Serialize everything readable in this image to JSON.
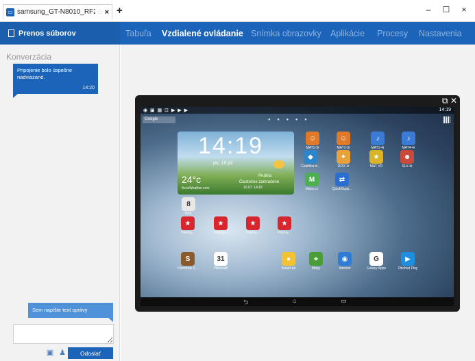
{
  "window": {
    "tab_title": "samsung_GT-N8010_RF2DB107KNV",
    "tab_star": "☆",
    "tab_close": "×",
    "new_tab": "+",
    "minimize": "–",
    "maximize": "☐",
    "close": "×"
  },
  "nav": {
    "file_transfer": "Prenos súborov",
    "items": [
      {
        "label": "Tabuľa"
      },
      {
        "label": "Vzdialené ovládanie"
      },
      {
        "label": "Snímka obrazovky"
      },
      {
        "label": "Aplikácie"
      },
      {
        "label": "Procesy"
      },
      {
        "label": "Nastavenia"
      }
    ],
    "active_index": 1
  },
  "sidebar": {
    "title": "Konverzácia",
    "messages": [
      {
        "text": "Pripojenie bolo úspešne nadviazané.",
        "time": "14:20"
      }
    ],
    "placeholder_bubble": "Sem napíšte text správy",
    "input_value": "",
    "send_label": "Odoslať"
  },
  "device": {
    "status_time": "14:19",
    "status_left": "◉ ▣ ▦ ⊡ ▶ ▶ ▶",
    "google_label": "Google",
    "clock": "14:19",
    "date": "po, 10 júl",
    "temperature": "24°c",
    "city": "Prutina",
    "condition": "Čiastočne zamračené",
    "weather_source": "AccuWeather.com",
    "updated": "10.07. 14:18",
    "apps": [
      {
        "label": "MAT1-3r",
        "color": "#e07a2a",
        "glyph": "☺"
      },
      {
        "label": "MAT1-3r",
        "color": "#e07a2a",
        "glyph": "☺"
      },
      {
        "label": "MAT1-4r",
        "color": "#3a7bd5",
        "glyph": "♪"
      },
      {
        "label": "MAT4-4r",
        "color": "#3a7bd5",
        "glyph": "♪"
      },
      {
        "label": "Cestička d...",
        "color": "#2c86c9",
        "glyph": "◆"
      },
      {
        "label": "DOV-1r",
        "color": "#e9a23b",
        "glyph": "✦"
      },
      {
        "label": "MAT VR",
        "color": "#d9b42a",
        "glyph": "★"
      },
      {
        "label": "SLV-4r",
        "color": "#c94a3a",
        "glyph": "☻"
      },
      {
        "label": "Mapy.cz",
        "color": "#4caf50",
        "glyph": "M"
      },
      {
        "label": "QuickSupp...",
        "color": "#2a6fd0",
        "glyph": "⇄"
      },
      {
        "label": "PPK",
        "color": "#e8e8e8",
        "glyph": "8"
      },
      {
        "label": "Priloha...",
        "color": "#d7262e",
        "glyph": "★"
      },
      {
        "label": "Priloha...",
        "color": "#d7262e",
        "glyph": "★"
      },
      {
        "label": "Priloha...",
        "color": "#d7262e",
        "glyph": "★"
      },
      {
        "label": "Priloha...",
        "color": "#d7262e",
        "glyph": "★"
      },
      {
        "label": "Pomôcka S...",
        "color": "#8a5a2b",
        "glyph": "S"
      },
      {
        "label": "Plánovač",
        "color": "#ffffff",
        "glyph": "31"
      },
      {
        "label": "Smart-ek",
        "color": "#f1c232",
        "glyph": "●"
      },
      {
        "label": "Mapy",
        "color": "#4a9e3a",
        "glyph": "⌖"
      },
      {
        "label": "Internet",
        "color": "#2e7cd6",
        "glyph": "◉"
      },
      {
        "label": "Galaxy Apps",
        "color": "#ffffff",
        "glyph": "G"
      },
      {
        "label": "Obchod Play",
        "color": "#1f8de0",
        "glyph": "▶"
      }
    ],
    "keys": {
      "back": "⮌",
      "home": "⌂",
      "recent": "▭"
    }
  },
  "colors": {
    "brand": "#1b64b9",
    "bubble_out": "#4f92d9",
    "sidebar_bg": "#f2f2f2"
  },
  "icons": {
    "tab_icon": "screen-icon",
    "file_icon": "document-icon",
    "popout": "popout-icon",
    "close_view": "close-icon",
    "attach": "image-icon",
    "contact": "person-icon"
  }
}
